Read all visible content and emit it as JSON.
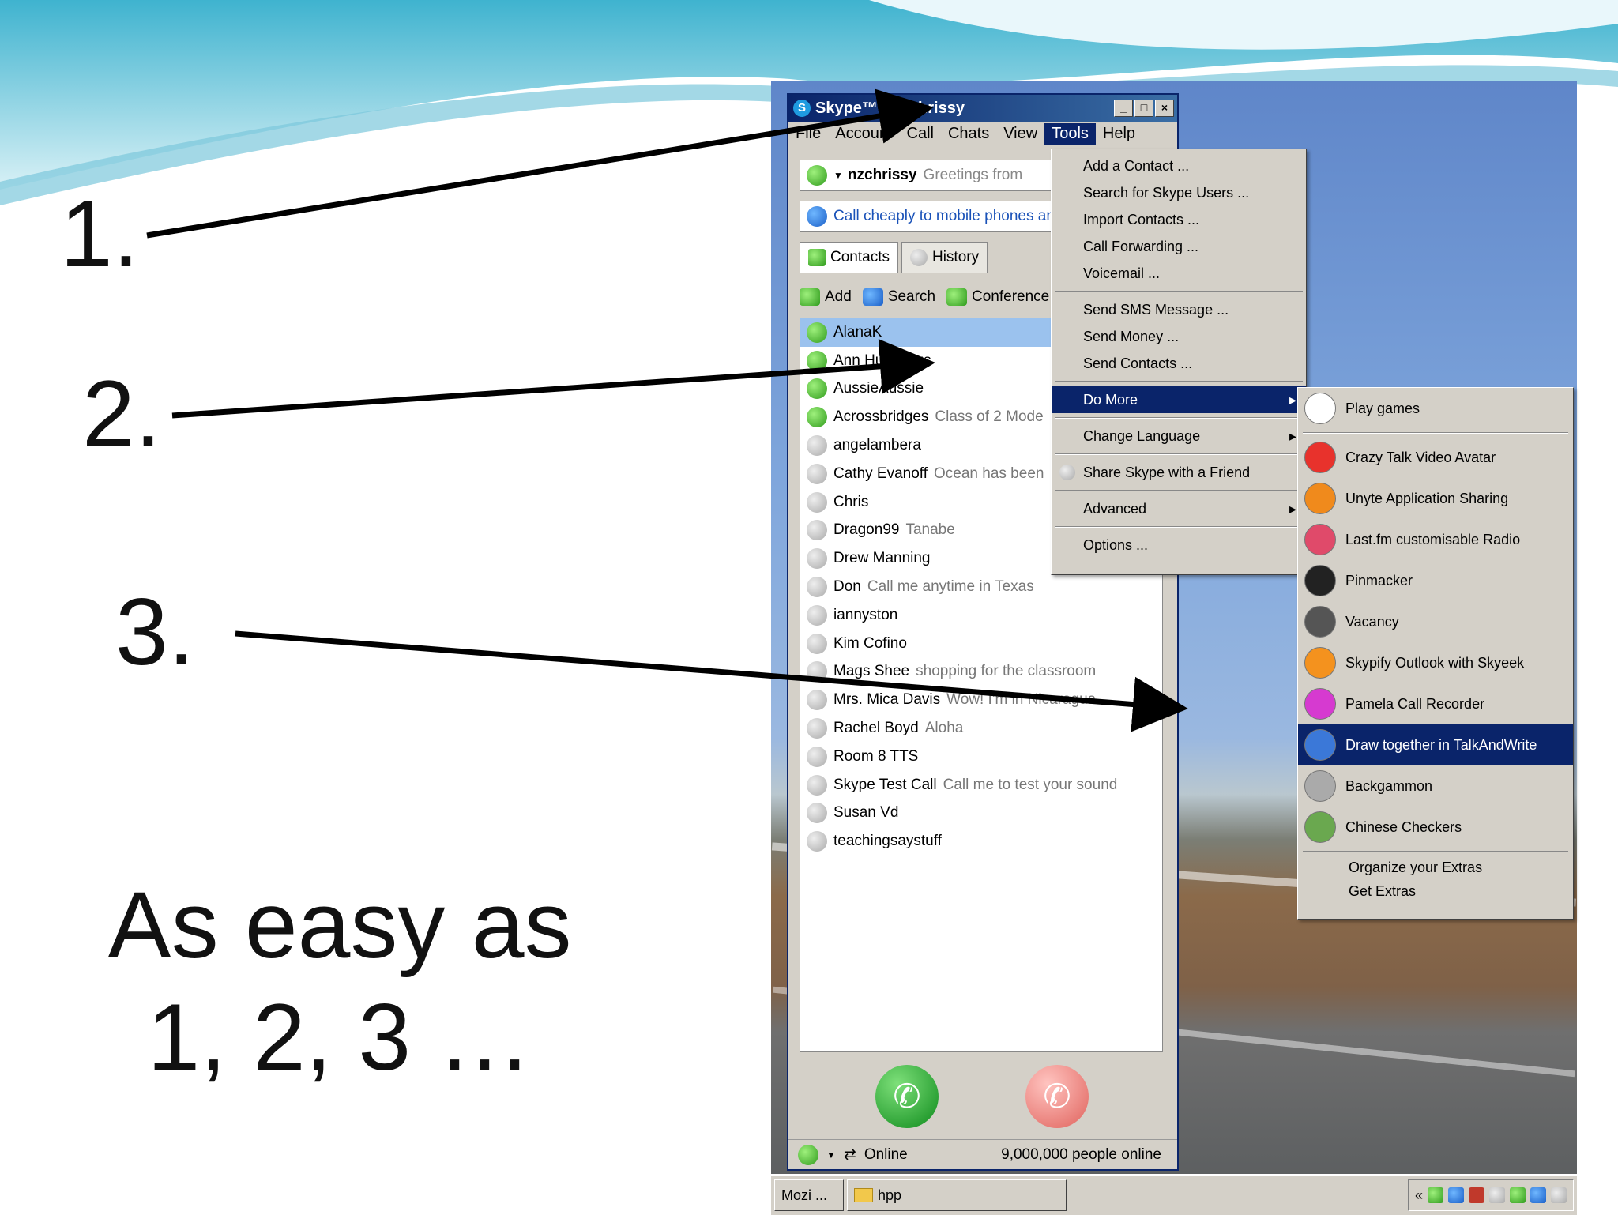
{
  "slide": {
    "step1": "1.",
    "step2": "2.",
    "step3": "3.",
    "caption_line1": "As easy as",
    "caption_line2": "1, 2, 3 …"
  },
  "window": {
    "title": "Skype™ - nzchrissy",
    "menu": [
      "File",
      "Account",
      "Call",
      "Chats",
      "View",
      "Tools",
      "Help"
    ],
    "active_menu": "Tools"
  },
  "status": {
    "username": "nzchrissy",
    "mood": "Greetings from"
  },
  "promo": "Call cheaply to mobile phones and",
  "tabs": [
    "Contacts",
    "History"
  ],
  "toolbar": [
    "Add",
    "Search",
    "Conference"
  ],
  "contacts": [
    {
      "name": "AlanaK",
      "sub": "",
      "online": true,
      "selected": true
    },
    {
      "name": "Ann Hutchings",
      "sub": "",
      "online": true
    },
    {
      "name": "AussieAussie",
      "sub": "",
      "online": true
    },
    {
      "name": "Acrossbridges",
      "sub": "Class of 2 Mode",
      "online": true
    },
    {
      "name": "angelambera",
      "sub": "",
      "online": false
    },
    {
      "name": "Cathy Evanoff",
      "sub": "Ocean has been",
      "online": false
    },
    {
      "name": "Chris",
      "sub": "",
      "online": false
    },
    {
      "name": "Dragon99",
      "sub": "Tanabe",
      "online": false
    },
    {
      "name": "Drew Manning",
      "sub": "",
      "online": false
    },
    {
      "name": "Don",
      "sub": "Call me anytime in Texas",
      "online": false
    },
    {
      "name": "iannyston",
      "sub": "",
      "online": false
    },
    {
      "name": "Kim Cofino",
      "sub": "",
      "online": false
    },
    {
      "name": "Mags Shee",
      "sub": "shopping for the classroom",
      "online": false
    },
    {
      "name": "Mrs. Mica Davis",
      "sub": "Wow! I'm in Nicaragua",
      "online": false
    },
    {
      "name": "Rachel Boyd",
      "sub": "Aloha",
      "online": false
    },
    {
      "name": "Room 8 TTS",
      "sub": "",
      "online": false
    },
    {
      "name": "Skype Test Call",
      "sub": "Call me to test your sound",
      "online": false
    },
    {
      "name": "Susan Vd",
      "sub": "",
      "online": false
    },
    {
      "name": "teachingsaystuff",
      "sub": "",
      "online": false
    }
  ],
  "statusbar": {
    "state": "Online",
    "count": "9,000,000 people online"
  },
  "tools_menu": {
    "group1": [
      "Add a Contact ...",
      "Search for Skype Users ...",
      "Import Contacts ...",
      "Call Forwarding ...",
      "Voicemail ..."
    ],
    "group2": [
      "Send SMS Message ...",
      "Send Money ...",
      "Send Contacts ..."
    ],
    "do_more": "Do More",
    "change_language": "Change Language",
    "share": "Share Skype with a Friend",
    "advanced": "Advanced",
    "options": "Options ..."
  },
  "more_menu": {
    "items": [
      {
        "label": "Play games",
        "icon": "cards-icon",
        "color": "#ffffff"
      },
      {
        "label": "Crazy Talk Video Avatar",
        "icon": "crazytalk-icon",
        "color": "#e8322c"
      },
      {
        "label": "Unyte Application Sharing",
        "icon": "unyte-icon",
        "color": "#f08a1c"
      },
      {
        "label": "Last.fm customisable Radio",
        "icon": "lastfm-icon",
        "color": "#e04a6a"
      },
      {
        "label": "Pinmacker",
        "icon": "spider-icon",
        "color": "#222222"
      },
      {
        "label": "Vacancy",
        "icon": "clapper-icon",
        "color": "#555555"
      },
      {
        "label": "Skypify Outlook with Skyeek",
        "icon": "skyeek-icon",
        "color": "#f4921e"
      },
      {
        "label": "Pamela Call Recorder",
        "icon": "pamela-icon",
        "color": "#d63ad0"
      },
      {
        "label": "Draw together in TalkAndWrite",
        "icon": "talkandwrite-icon",
        "color": "#3b78d8",
        "highlighted": true
      },
      {
        "label": "Backgammon",
        "icon": "dice-icon",
        "color": "#aaaaaa"
      },
      {
        "label": "Chinese Checkers",
        "icon": "checkers-icon",
        "color": "#6aa84f"
      }
    ],
    "organize": "Organize your Extras",
    "get_extras": "Get Extras"
  },
  "taskbar": {
    "task1": "Mozi ...",
    "task2": "hpp"
  }
}
